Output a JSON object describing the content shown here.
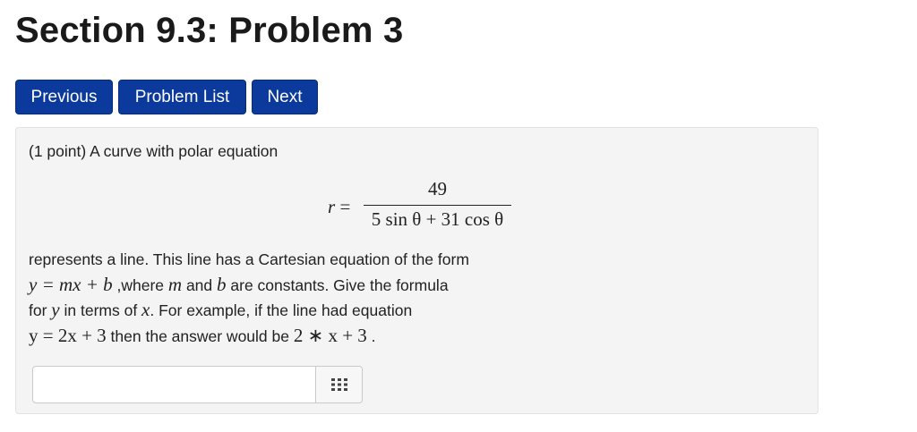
{
  "page": {
    "title": "Section 9.3: Problem 3"
  },
  "nav": {
    "previous": "Previous",
    "problem_list": "Problem List",
    "next": "Next"
  },
  "problem": {
    "intro": "(1 point) A curve with polar equation",
    "equation": {
      "lhs": "r =",
      "numerator": "49",
      "denominator": "5 sin θ + 31 cos θ"
    },
    "line1": "represents a line. This line has a Cartesian equation of the form",
    "line2": {
      "math1": "y = mx + b",
      "text1": " ,where ",
      "m": "m",
      "text2": " and ",
      "b": "b",
      "text3": " are constants. Give the formula"
    },
    "line3": {
      "text1": "for ",
      "y": "y",
      "text2": " in terms of ",
      "x": "x",
      "text3": ". For example, if the line had equation"
    },
    "line4": {
      "math1": "y = 2x + 3",
      "text1": " then the answer would be ",
      "math2": "2 ∗ x + 3",
      "text2": " ."
    }
  },
  "answer": {
    "value": "",
    "placeholder": ""
  },
  "icons": {
    "keyboard": "keypad-grid-icon"
  }
}
